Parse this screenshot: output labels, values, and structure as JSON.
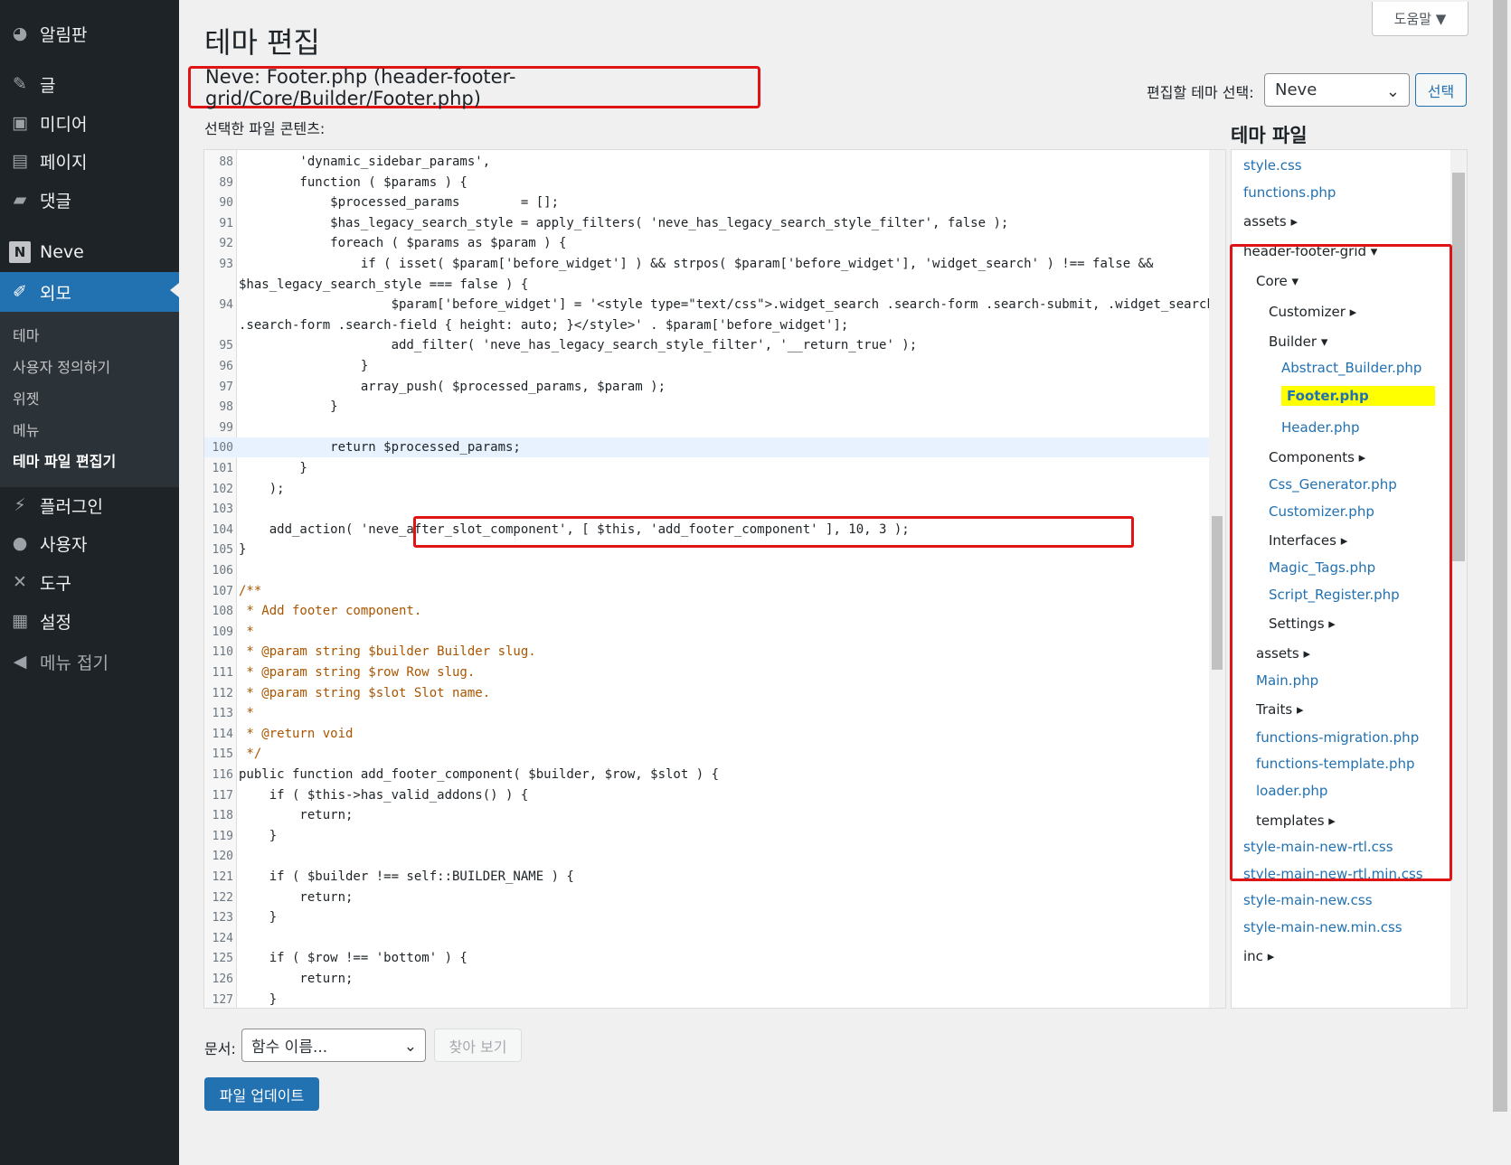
{
  "sidebar": {
    "items": [
      {
        "label": "알림판",
        "icon": "dashboard-icon"
      },
      {
        "label": "글",
        "icon": "pin-icon"
      },
      {
        "label": "미디어",
        "icon": "media-icon"
      },
      {
        "label": "페이지",
        "icon": "page-icon"
      },
      {
        "label": "댓글",
        "icon": "comment-icon"
      },
      {
        "label": "Neve",
        "icon": "neve-icon"
      },
      {
        "label": "외모",
        "icon": "brush-icon"
      },
      {
        "label": "플러그인",
        "icon": "plugin-icon"
      },
      {
        "label": "사용자",
        "icon": "user-icon"
      },
      {
        "label": "도구",
        "icon": "wrench-icon"
      },
      {
        "label": "설정",
        "icon": "settings-icon"
      },
      {
        "label": "메뉴 접기",
        "icon": "collapse-icon"
      }
    ],
    "submenu": [
      "테마",
      "사용자 정의하기",
      "위젯",
      "메뉴",
      "테마 파일 편집기"
    ]
  },
  "header": {
    "help_label": "도움말 ▼",
    "title": "테마 편집",
    "file_heading": "Neve: Footer.php (header-footer-grid/Core/Builder/Footer.php)",
    "select_label": "편집할 테마 선택:",
    "theme_value": "Neve",
    "select_button": "선택",
    "content_label": "선택한 파일 콘텐츠:",
    "files_heading": "테마 파일"
  },
  "code": {
    "line_numbers": [
      "88",
      "89",
      "90",
      "91",
      "92",
      "93",
      "",
      "94",
      "",
      "95",
      "96",
      "97",
      "98",
      "99",
      "100",
      "101",
      "102",
      "103",
      "104",
      "105",
      "106",
      "107",
      "108",
      "109",
      "110",
      "111",
      "112",
      "113",
      "114",
      "115",
      "116",
      "117",
      "118",
      "119",
      "120",
      "121",
      "122",
      "123",
      "124",
      "125",
      "126",
      "127"
    ],
    "lines": [
      "        'dynamic_sidebar_params',",
      "        function ( $params ) {",
      "            $processed_params        = [];",
      "            $has_legacy_search_style = apply_filters( 'neve_has_legacy_search_style_filter', false );",
      "            foreach ( $params as $param ) {",
      "                if ( isset( $param['before_widget'] ) && strpos( $param['before_widget'], 'widget_search' ) !== false &&",
      "$has_legacy_search_style === false ) {",
      "                    $param['before_widget'] = '<style type=\"text/css\">.widget_search .search-form .search-submit, .widget_search",
      ".search-form .search-field { height: auto; }</style>' . $param['before_widget'];",
      "                    add_filter( 'neve_has_legacy_search_style_filter', '__return_true' );",
      "                }",
      "                array_push( $processed_params, $param );",
      "            }",
      "",
      "            return $processed_params;",
      "        }",
      "    );",
      "",
      "    add_action( 'neve_after_slot_component', [ $this, 'add_footer_component' ], 10, 3 );",
      "}",
      "",
      "/**",
      " * Add footer component.",
      " *",
      " * @param string $builder Builder slug.",
      " * @param string $row Row slug.",
      " * @param string $slot Slot name.",
      " *",
      " * @return void",
      " */",
      "public function add_footer_component( $builder, $row, $slot ) {",
      "    if ( $this->has_valid_addons() ) {",
      "        return;",
      "    }",
      "",
      "    if ( $builder !== self::BUILDER_NAME ) {",
      "        return;",
      "    }",
      "",
      "    if ( $row !== 'bottom' ) {",
      "        return;",
      "    }"
    ]
  },
  "tree": [
    {
      "label": "style.css",
      "type": "link"
    },
    {
      "label": "functions.php",
      "type": "link"
    },
    {
      "label": "assets ▸",
      "type": "dir"
    },
    {
      "label": "header-footer-grid ▾",
      "type": "dir"
    },
    {
      "label": "Core ▾",
      "type": "dir"
    },
    {
      "label": "Customizer ▸",
      "type": "dir"
    },
    {
      "label": "Builder ▾",
      "type": "dir"
    },
    {
      "label": "Abstract_Builder.php",
      "type": "link"
    },
    {
      "label": "Footer.php",
      "type": "current"
    },
    {
      "label": "Header.php",
      "type": "link"
    },
    {
      "label": "Components ▸",
      "type": "dir"
    },
    {
      "label": "Css_Generator.php",
      "type": "link"
    },
    {
      "label": "Customizer.php",
      "type": "link"
    },
    {
      "label": "Interfaces ▸",
      "type": "dir"
    },
    {
      "label": "Magic_Tags.php",
      "type": "link"
    },
    {
      "label": "Script_Register.php",
      "type": "link"
    },
    {
      "label": "Settings ▸",
      "type": "dir"
    },
    {
      "label": "assets ▸",
      "type": "dir"
    },
    {
      "label": "Main.php",
      "type": "link"
    },
    {
      "label": "Traits ▸",
      "type": "dir"
    },
    {
      "label": "functions-migration.php",
      "type": "link"
    },
    {
      "label": "functions-template.php",
      "type": "link"
    },
    {
      "label": "loader.php",
      "type": "link"
    },
    {
      "label": "templates ▸",
      "type": "dir"
    },
    {
      "label": "style-main-new-rtl.css",
      "type": "link"
    },
    {
      "label": "style-main-new-rtl.min.css",
      "type": "link"
    },
    {
      "label": "style-main-new.css",
      "type": "link"
    },
    {
      "label": "style-main-new.min.css",
      "type": "link"
    },
    {
      "label": "inc ▸",
      "type": "dir"
    }
  ],
  "footer": {
    "doc_label": "문서:",
    "doc_select": "함수 이름...",
    "lookup_button": "찾아 보기",
    "update_button": "파일 업데이트"
  },
  "colors": {
    "accent": "#2271b1",
    "highlight": "#e01414",
    "sidebar_bg": "#1d2327"
  }
}
